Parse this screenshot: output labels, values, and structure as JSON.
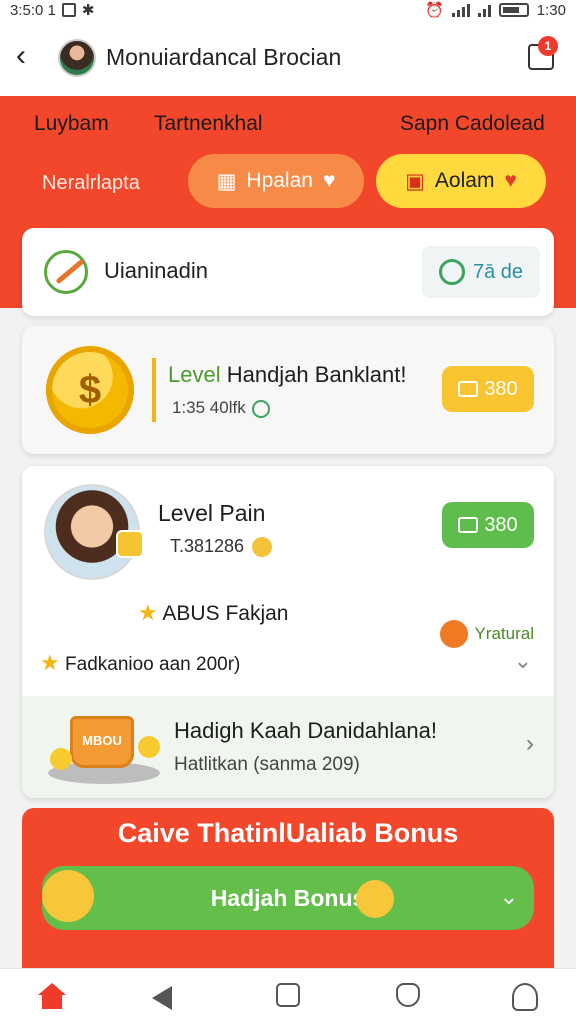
{
  "status_bar": {
    "time_left": "3:5:0 1",
    "time_right": "1:30"
  },
  "header": {
    "back_label": "‹",
    "title": "Monuiardancal Brocian",
    "badge": "1"
  },
  "tabs": [
    "Luybam",
    "Tartnenkhal",
    "Sapn Cadolead"
  ],
  "top_banner": {
    "sub_label": "Neralrlapta",
    "pill_orange": "Hpalan",
    "pill_yellow": "Aolam"
  },
  "search_card": {
    "label": "Uianinadin",
    "chip_text": "7ā de"
  },
  "level_card": {
    "title_prefix": "Level",
    "title_main": " Handjah Banklant!",
    "subtitle": "1:35 40lfk",
    "button_value": "380"
  },
  "profile_card": {
    "name": "Level Pain",
    "points": "T.381286",
    "button_value": "380",
    "promo_title": "ABUS Fakjan",
    "promo_tag": "Yratural",
    "meta_line": "Fadkanioo aan 200r)",
    "sub_title": "Hadigh Kaah Danidahlana!",
    "sub_meta": "Hatlitkan (sanma 209)",
    "cup_label": "MBOU"
  },
  "bonus": {
    "title": "Caive ThatinlUaliab Bonus",
    "button_label": "Hadjah Bonus"
  },
  "bottom_nav": [
    {
      "icon": "home-icon"
    },
    {
      "icon": "back-icon"
    },
    {
      "icon": "square-icon"
    },
    {
      "icon": "shield-icon"
    },
    {
      "icon": "profile-icon"
    }
  ],
  "colors": {
    "accent_red": "#f2472b",
    "green": "#5ebd4c",
    "yellow": "#f8c42f"
  }
}
